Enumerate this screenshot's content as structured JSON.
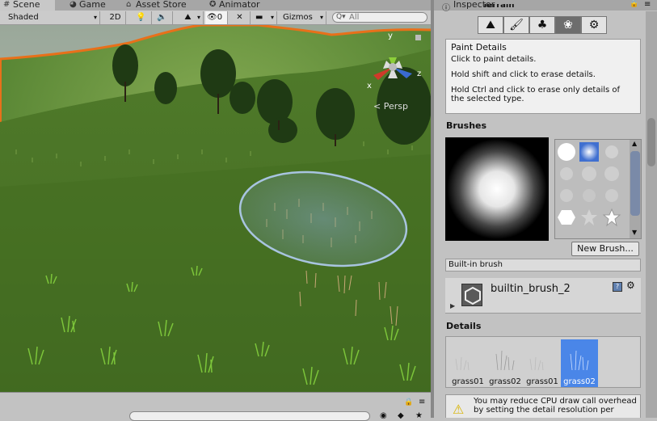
{
  "tabs": {
    "scene": "Scene",
    "game": "Game",
    "asset_store": "Asset Store",
    "animator": "Animator"
  },
  "scene_toolbar": {
    "shading_mode": "Shaded",
    "mode_2d": "2D",
    "hidden_count": "0",
    "gizmos": "Gizmos",
    "search_placeholder": "All"
  },
  "scene": {
    "persp_label": "< Persp",
    "gizmo_axes": {
      "y": "y",
      "z": "z",
      "x": "x"
    }
  },
  "inspector": {
    "tab_label": "Inspector",
    "component_partial": "Terrain",
    "tool_icons": [
      "raise-lower-icon",
      "paint-texture-icon",
      "place-trees-icon",
      "paint-details-icon",
      "settings-icon"
    ],
    "info": {
      "title": "Paint Details",
      "line1": "Click to paint details.",
      "line2": "Hold shift and click to erase details.",
      "line3": "Hold Ctrl and click to erase only details of the selected type."
    },
    "brushes_title": "Brushes",
    "new_brush_button": "New Brush...",
    "builtin_brush_label": "Built-in brush",
    "asset_name": "builtin_brush_2",
    "details_title": "Details",
    "details": [
      {
        "label": "grass01"
      },
      {
        "label": "grass02"
      },
      {
        "label": "grass01"
      },
      {
        "label": "grass02"
      }
    ],
    "warning": "You may reduce CPU draw call overhead by setting the detail resolution per"
  },
  "colors": {
    "selection_blue": "#4a86e8",
    "terrain_outline": "#e8701a",
    "brush_projector": "#a8c4e0"
  }
}
